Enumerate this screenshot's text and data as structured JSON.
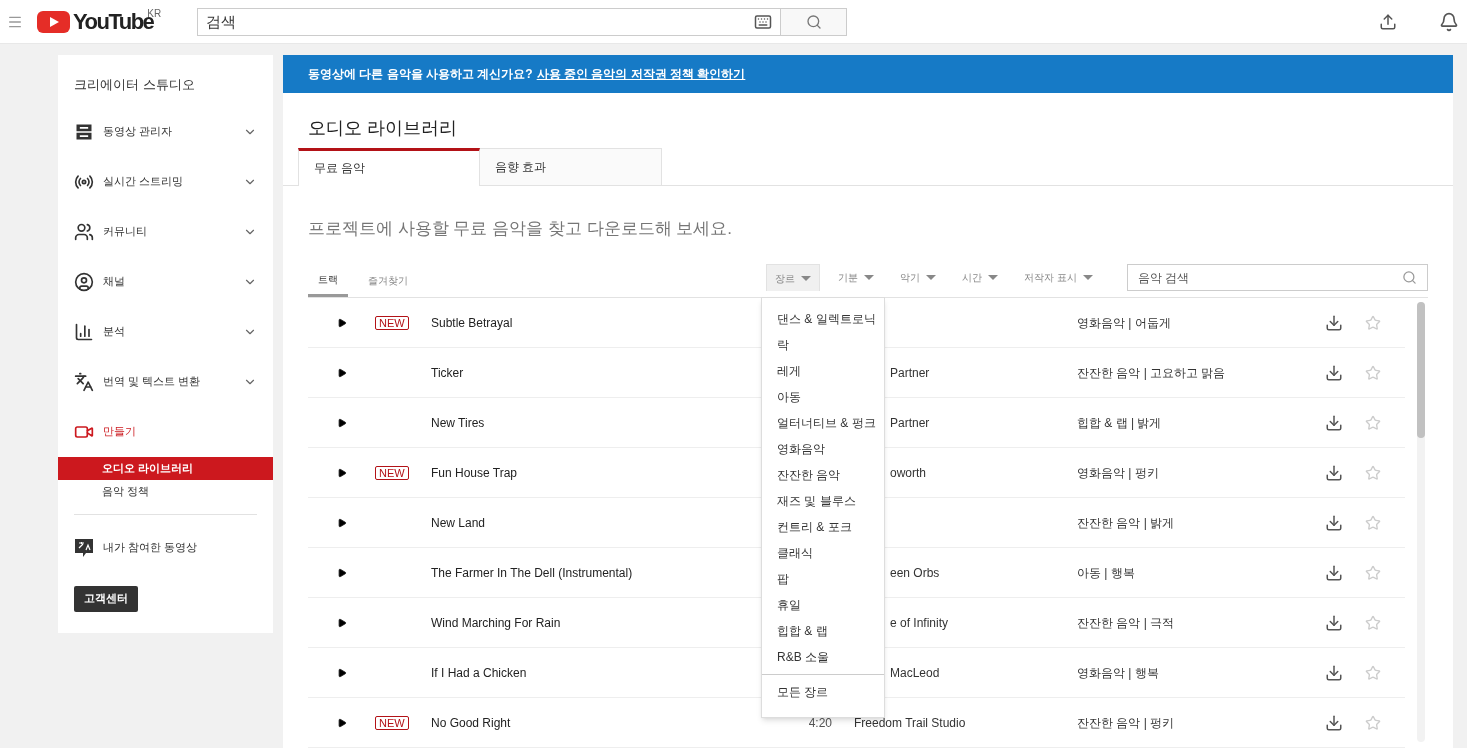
{
  "header": {
    "logo_text": "YouTube",
    "logo_region": "KR",
    "search": {
      "placeholder": "검색"
    }
  },
  "sidebar": {
    "title": "크리에이터 스튜디오",
    "items": [
      {
        "label": "동영상 관리자",
        "expandable": true,
        "selected": false
      },
      {
        "label": "실시간 스트리밍",
        "expandable": true,
        "selected": false
      },
      {
        "label": "커뮤니티",
        "expandable": true,
        "selected": false
      },
      {
        "label": "채널",
        "expandable": true,
        "selected": false
      },
      {
        "label": "분석",
        "expandable": true,
        "selected": false
      },
      {
        "label": "번역 및 텍스트 변환",
        "expandable": true,
        "selected": false
      },
      {
        "label": "만들기",
        "expandable": false,
        "selected": true,
        "children": [
          {
            "label": "오디오 라이브러리",
            "selected": true
          },
          {
            "label": "음악 정책",
            "selected": false
          }
        ]
      }
    ],
    "secondary": "내가 참여한 동영상",
    "help_button": "고객센터"
  },
  "banner": {
    "text": "동영상에 다른 음악을 사용하고 계신가요?",
    "link": "사용 중인 음악의 저작권 정책 확인하기"
  },
  "page_title": "오디오 라이브러리",
  "tabs": [
    {
      "label": "무료 음악",
      "selected": true
    },
    {
      "label": "음향 효과",
      "selected": false
    }
  ],
  "description": "프로젝트에 사용할 무료 음악을 찾고 다운로드해 보세요.",
  "subtabs": [
    {
      "label": "트랙",
      "selected": true
    },
    {
      "label": "즐겨찾기",
      "selected": false
    }
  ],
  "filters": [
    {
      "label": "장르",
      "open": true
    },
    {
      "label": "기분",
      "open": false
    },
    {
      "label": "악기",
      "open": false
    },
    {
      "label": "시간",
      "open": false
    },
    {
      "label": "저작자 표시",
      "open": false
    }
  ],
  "music_search": {
    "placeholder": "음악 검색"
  },
  "genre_menu": {
    "options": [
      "댄스 & 일렉트로닉",
      "락",
      "레게",
      "아동",
      "얼터너티브 & 펑크",
      "영화음악",
      "잔잔한 음악",
      "재즈 및 블루스",
      "컨트리 & 포크",
      "클래식",
      "팝",
      "휴일",
      "힙합 & 랩",
      "R&B 소울"
    ],
    "all": "모든 장르"
  },
  "tracks": [
    {
      "title": "Subtle Betrayal",
      "new": true,
      "new_label": "NEW",
      "genre_mood": "영화음악 | 어둡게",
      "starred": false
    },
    {
      "title": "Ticker",
      "new": false,
      "artist": "Partner",
      "genre_mood": "잔잔한 음악 | 고요하고 맑음",
      "starred": false
    },
    {
      "title": "New Tires",
      "new": false,
      "artist": "Partner",
      "genre_mood": "힙합 & 랩 | 밝게",
      "starred": false
    },
    {
      "title": "Fun House Trap",
      "new": true,
      "new_label": "NEW",
      "artist": "oworth",
      "genre_mood": "영화음악 | 펑키",
      "starred": false
    },
    {
      "title": "New Land",
      "new": false,
      "genre_mood": "잔잔한 음악 | 밝게",
      "starred": false
    },
    {
      "title": "The Farmer In The Dell (Instrumental)",
      "new": false,
      "artist": "een Orbs",
      "genre_mood": "아동 | 행복",
      "starred": false
    },
    {
      "title": "Wind Marching For Rain",
      "new": false,
      "artist": "e of Infinity",
      "genre_mood": "잔잔한 음악 | 극적",
      "starred": false
    },
    {
      "title": "If I Had a Chicken",
      "new": false,
      "artist": "MacLeod",
      "genre_mood": "영화음악 | 행복",
      "starred": false
    },
    {
      "title": "No Good Right",
      "new": true,
      "new_label": "NEW",
      "duration": "4:20",
      "artist": "Freedom Trail Studio",
      "genre_mood": "잔잔한 음악 | 펑키",
      "starred": false
    }
  ]
}
